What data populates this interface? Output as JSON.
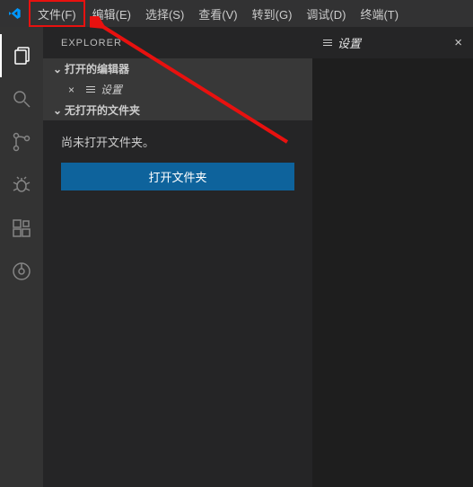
{
  "menubar": {
    "file": "文件(F)",
    "edit": "编辑(E)",
    "select": "选择(S)",
    "view": "查看(V)",
    "goto": "转到(G)",
    "debug": "调试(D)",
    "terminal": "终端(T)"
  },
  "sidebar": {
    "title": "EXPLORER",
    "open_editors_label": "打开的编辑器",
    "open_editor_item": "设置",
    "no_folder_section": "无打开的文件夹",
    "no_folder_msg": "尚未打开文件夹。",
    "open_folder_btn": "打开文件夹"
  },
  "editor": {
    "tab_label": "设置"
  }
}
